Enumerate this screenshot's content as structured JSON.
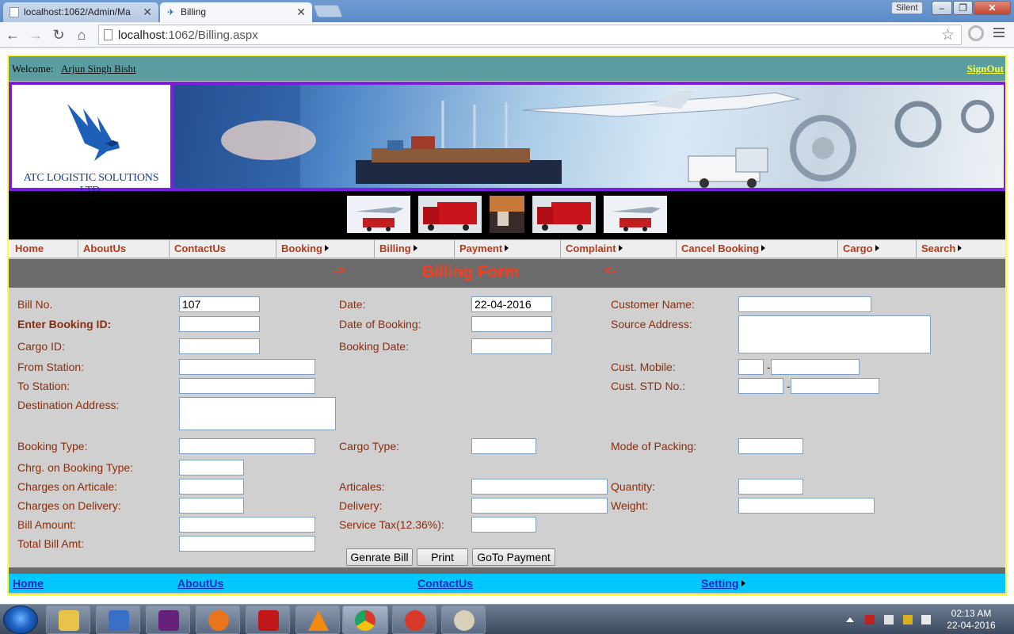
{
  "browser": {
    "tabs": [
      {
        "title": "localhost:1062/Admin/Ma",
        "active": false
      },
      {
        "title": "Billing",
        "active": true
      }
    ],
    "profile_badge": "Silent",
    "url_host": "localhost",
    "url_rest": ":1062/Billing.aspx"
  },
  "site": {
    "welcome_label": "Welcome:",
    "user_name": "Arjun Singh Bisht",
    "signout": "SignOut",
    "logo_text": "ATC LOGISTIC SOLUTIONS LTD.",
    "colors": {
      "header_bar": "#5a9ea2",
      "accent_text": "#b43a1a",
      "banner_frame": "#7a1ee0",
      "footer_bar": "#00c8ff",
      "title_red": "#ff3a1a"
    }
  },
  "nav": [
    {
      "label": "Home",
      "submenu": false
    },
    {
      "label": "AboutUs",
      "submenu": false
    },
    {
      "label": "ContactUs",
      "submenu": false
    },
    {
      "label": "Booking",
      "submenu": true
    },
    {
      "label": "Billing",
      "submenu": true
    },
    {
      "label": "Payment",
      "submenu": true
    },
    {
      "label": "Complaint",
      "submenu": true
    },
    {
      "label": "Cancel Booking",
      "submenu": true
    },
    {
      "label": "Cargo",
      "submenu": true
    },
    {
      "label": "Search",
      "submenu": true
    }
  ],
  "form": {
    "arrow_left": "->",
    "title": "Billing Form",
    "arrow_right": "<-",
    "labels": {
      "bill_no": "Bill No.",
      "booking_id": "Enter Booking ID:",
      "cargo_id": "Cargo ID:",
      "from_station": "From Station:",
      "to_station": "To Station:",
      "destination_address": "Destination Address:",
      "booking_type": "Booking Type:",
      "chrg_booking_type": "Chrg. on Booking Type:",
      "charges_articale": "Charges on Articale:",
      "charges_delivery": "Charges on Delivery:",
      "bill_amount": "Bill Amount:",
      "total_bill": "Total Bill Amt:",
      "date": "Date:",
      "date_of_booking": "Date of Booking:",
      "booking_date": "Booking Date:",
      "cargo_type": "Cargo Type:",
      "articales": "Articales:",
      "delivery": "Delivery:",
      "service_tax": "Service Tax(12.36%):",
      "customer_name": "Customer Name:",
      "source_address": "Source Address:",
      "cust_mobile": "Cust. Mobile:",
      "cust_std": "Cust. STD No.:",
      "mode_packing": "Mode of Packing:",
      "quantity": "Quantity:",
      "weight": "Weight:"
    },
    "values": {
      "bill_no": "107",
      "date": "22-04-2016"
    },
    "separator": "-",
    "buttons": {
      "generate": "Genrate Bill",
      "print": "Print",
      "payment": "GoTo Payment"
    }
  },
  "footer": [
    {
      "label": "Home",
      "submenu": false
    },
    {
      "label": "AboutUs",
      "submenu": false
    },
    {
      "label": "ContactUs",
      "submenu": false
    },
    {
      "label": "Setting",
      "submenu": true
    }
  ],
  "taskbar": {
    "apps": [
      "file-explorer-icon",
      "media-player-icon",
      "visual-studio-icon",
      "firefox-icon",
      "acrobat-icon",
      "vlc-icon",
      "chrome-icon",
      "ccleaner-icon",
      "paint-icon"
    ],
    "time": "02:13 AM",
    "date": "22-04-2016"
  }
}
